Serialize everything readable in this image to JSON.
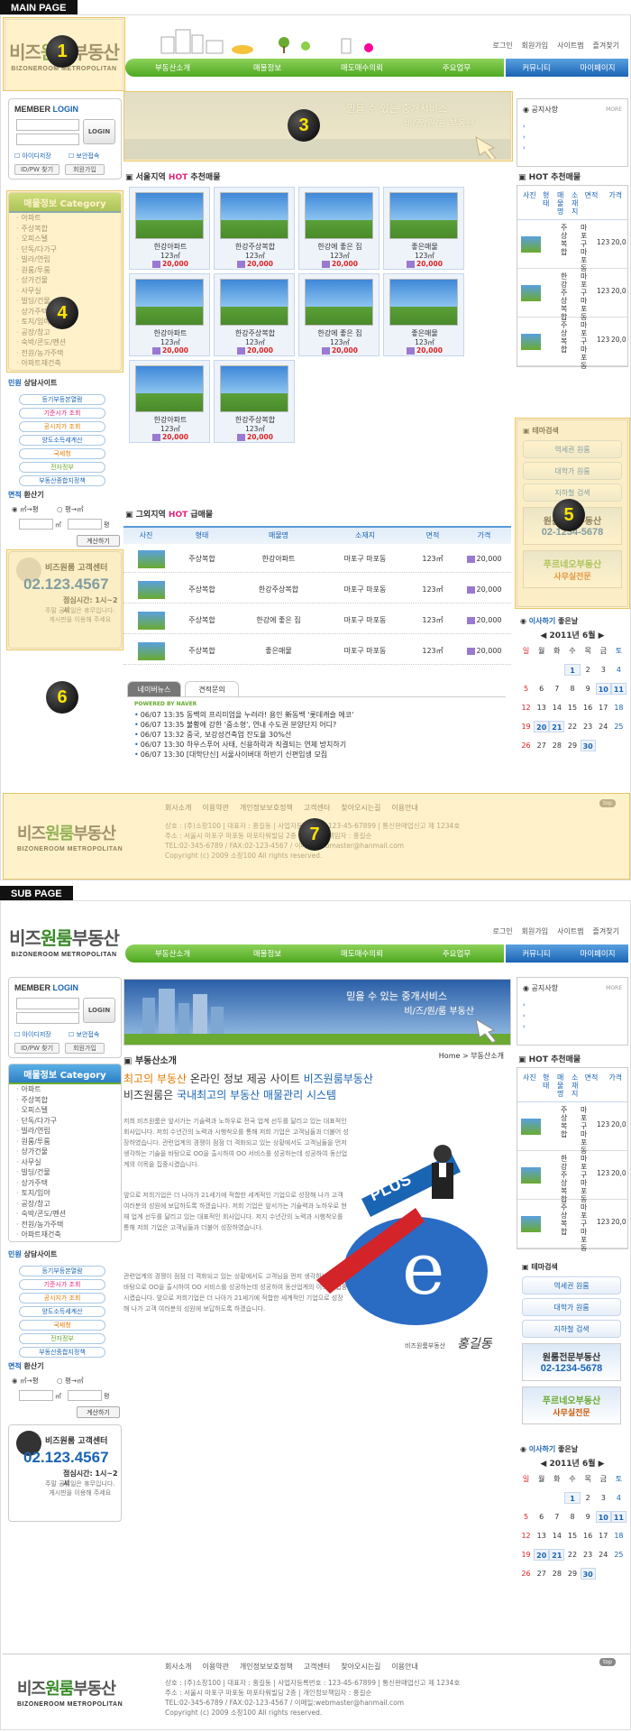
{
  "labels": {
    "main": "MAIN PAGE",
    "sub": "SUB PAGE"
  },
  "logo": {
    "text_a": "비즈",
    "text_b": "원룸",
    "text_c": "부동산",
    "sub": "BIZONEROOM METROPOLITAN"
  },
  "top_links": [
    "로그인",
    "회원가입",
    "사이트맵",
    "즐겨찾기"
  ],
  "menu": [
    "부동산소개",
    "매물정보",
    "매도매수의뢰",
    "주요업무"
  ],
  "menu_right": [
    "커뮤니티",
    "마이페이지"
  ],
  "login": {
    "title_a": "MEMBER",
    "title_b": "LOGIN",
    "btn": "LOGIN",
    "save_id": "아이디저장",
    "secure": "보안접속",
    "find": "ID/PW 찾기",
    "join": "회원가입"
  },
  "category": {
    "title": "매물정보 Category",
    "items": [
      "아파트",
      "주상복합",
      "오피스텔",
      "단독/다가구",
      "빌라/연립",
      "원룸/투룸",
      "상가건물",
      "사무실",
      "빌딩/건물",
      "상가주택",
      "토지/임야",
      "공장/창고",
      "숙박/콘도/펜션",
      "전원/농가주택",
      "아파트재건축"
    ]
  },
  "consult": {
    "title_a": "민원",
    "title_b": "상담사이트",
    "links": [
      "등기부등본열람",
      "기준시가 조회",
      "공시지가 조회",
      "양도소득세계산",
      "국세청",
      "전자정부",
      "부동산종합지정책"
    ]
  },
  "calc": {
    "title_a": "면적",
    "title_b": "환산기",
    "opt1": "㎡→평",
    "opt2": "평→㎡",
    "unit1": "㎡",
    "unit2": "평",
    "btn": "계산하기"
  },
  "customer_center": {
    "title": "비즈원룸 고객센터",
    "phone": "02.123.4567",
    "hours": "점심시간: 1시~2시",
    "note1": "주말 공휴일은 휴무입니다.",
    "note2": "게시판을 이용해 주세요"
  },
  "banner": {
    "line1": "믿을 수 있는 중개서비스",
    "line2": "비/즈/원/룸 부동산"
  },
  "notice": {
    "title": "공지사항",
    "more": "MORE"
  },
  "hot_seoul": {
    "title_a": "서울지역",
    "title_b": "HOT",
    "title_c": "추천매물",
    "items": [
      {
        "name": "한강아파트",
        "area": "123㎡",
        "price": "20,000"
      },
      {
        "name": "한강주상복합",
        "area": "123㎡",
        "price": "20,000"
      },
      {
        "name": "한강에 좋은 집",
        "area": "123㎡",
        "price": "20,000"
      },
      {
        "name": "좋은매물",
        "area": "123㎡",
        "price": "20,000"
      },
      {
        "name": "한강아파트",
        "area": "123㎡",
        "price": "20,000"
      },
      {
        "name": "한강주상복합",
        "area": "123㎡",
        "price": "20,000"
      },
      {
        "name": "한강에 좋은 집",
        "area": "123㎡",
        "price": "20,000"
      },
      {
        "name": "좋은매물",
        "area": "123㎡",
        "price": "20,000"
      },
      {
        "name": "한강아파트",
        "area": "123㎡",
        "price": "20,000"
      },
      {
        "name": "한강주상복합",
        "area": "123㎡",
        "price": "20,000"
      }
    ]
  },
  "hot_side": {
    "title": "HOT 추천매물",
    "cols": [
      "사진",
      "형태",
      "매물명",
      "소재지",
      "면적",
      "가격"
    ],
    "rows": [
      {
        "type": "주상복합",
        "loc": "마포구마포동",
        "area": "123",
        "price": "20,0"
      },
      {
        "type": "한강주상복합",
        "loc": "마포구마포동",
        "area": "123",
        "price": "20,0"
      },
      {
        "type": "주상복합",
        "loc": "마포구마포동",
        "area": "123",
        "price": "20,0"
      }
    ]
  },
  "theme": {
    "title": "테마검색",
    "btns": [
      "역세권 원룸",
      "대학가 원룸",
      "지하철 검색"
    ],
    "banner1_a": "원룸전문부동산",
    "banner1_b": "02-1234-5678",
    "banner2_a": "푸르네오부동산",
    "banner2_b": "사무실전문"
  },
  "calendar": {
    "title_a": "이사하기",
    "title_b": "좋은날",
    "month": "2011년 6월",
    "days": [
      "일",
      "월",
      "화",
      "수",
      "목",
      "금",
      "토"
    ],
    "cells": [
      "",
      "",
      "",
      "1",
      "2",
      "3",
      "4",
      "5",
      "6",
      "7",
      "8",
      "9",
      "10",
      "11",
      "12",
      "13",
      "14",
      "15",
      "16",
      "17",
      "18",
      "19",
      "20",
      "21",
      "22",
      "23",
      "24",
      "25",
      "26",
      "27",
      "28",
      "29",
      "30",
      "",
      ""
    ]
  },
  "hot_other": {
    "title_a": "그외지역",
    "title_b": "HOT",
    "title_c": "급매물",
    "cols": [
      "사진",
      "형태",
      "매물명",
      "소재지",
      "면적",
      "가격"
    ],
    "rows": [
      {
        "type": "주상복합",
        "name": "한강아파트",
        "loc": "마포구 마포동",
        "area": "123㎡",
        "price": "20,000"
      },
      {
        "type": "주상복합",
        "name": "한강주상복합",
        "loc": "마포구 마포동",
        "area": "123㎡",
        "price": "20,000"
      },
      {
        "type": "주상복합",
        "name": "한강에 좋은 집",
        "loc": "마포구 마포동",
        "area": "123㎡",
        "price": "20,000"
      },
      {
        "type": "주상복합",
        "name": "좋은매물",
        "loc": "마포구 마포동",
        "area": "123㎡",
        "price": "20,000"
      }
    ]
  },
  "news": {
    "tab1": "네이버뉴스",
    "tab2": "견적문의",
    "powered": "POWERED BY NAVER",
    "items": [
      "06/07 13:35 동백의 프리미엄을 누려라! 용인 新동백 '롯데캐슬 에코'",
      "06/07 13:35 불황에 강한 '중소형', 연내 수도권 분양단지 어디?",
      "06/07 13:32 중국, 보강성건축업 잔도율 30%선",
      "06/07 13:30 하우스푸어 사태, 신용하락과 직결되는 연체 방치하기",
      "06/07 13:30 [대학단신] 서울사이버대 하반기 신편입생 모집"
    ]
  },
  "footer": {
    "links": [
      "회사소개",
      "이용약관",
      "개인정보보호정책",
      "고객센터",
      "찾아오시는길",
      "이용안내"
    ],
    "line1": "상호 : (주)소창100 | 대표자 : 홍길동 | 사업자등록번호 : 123-45-67899 | 통신판매업신고 제 1234호",
    "line2": "주소 : 서울시 마포구 마포동 마포타워빌딩 2층 | 개인정보책임자 : 홍길순",
    "line3": "TEL:02-345-6789 / FAX:02-123-4567 / 이메일:webmaster@hanmail.com",
    "line4": "Copyright (c) 2009 소창100 All rights reserved.",
    "top": "top"
  },
  "markers": [
    "1",
    "2",
    "3",
    "4",
    "5",
    "6",
    "7"
  ],
  "sub": {
    "breadcrumb_a": "Home",
    "breadcrumb_b": "> 부동산소개",
    "section_title": "부동산소개",
    "headline1_a": "최고의 부동산",
    "headline1_b": "온라인 정보 제공 사이트",
    "headline1_c": "비즈원룸부동산",
    "headline2_a": "비즈원룸은",
    "headline2_b": "국내최고의 부동산 매물관리 시스템",
    "paragraphs": [
      "저희 비즈원룸은 앞서가는 기술력과 노하우로 전국 업계 선두를 달리고 있는 대표적인 회사입니다. 저희 수년간의 노력과 시행착오를 통해 저희 기업은 고객님들과 더불어 성장하였습니다. 관련업계의 경쟁이 점점 더 격화되고 있는 상황에서도 고객님들을 먼저 생각하는 기술을 바탕으로 OO을 출시하여 OO 서비스를 성공하는데 성공하여 동산업계의 이목을 집중시켰습니다.",
      "앞으로 저희기업은 더 나아가 21세기에 적합한 세계적인 기업으로 성장해 나가 고객 여러분의 성원에 보답하도록 하겠습니다. 저희 기업은 앞서가는 기술력과 노하우로 현재 업계 선두를 달리고 있는 대표적인 회사입니다. 저지 수년간의 노력과 시행착오를 통해 저희 기업은 고객님들과 더불어 성장하였습니다.",
      "관련업계의 경쟁이 점점 더 격화되고 있는 상황에서도 고객님을 먼저 생각하는 기술을 바탕으로 OO을 출시하여 OO 서비스를 성공하는데 성공하여 동산업계의 이목을 집중시켰습니다. 앞으로 저희기업은 더 나아가 21세기에 적합한 세계적인 기업으로 성장해 나가 고객 여러분의 성원에 보답하도록 하겠습니다."
    ],
    "sign_a": "비즈원룸부동산",
    "sign_b": "홍길동",
    "plus": "PLUS"
  }
}
